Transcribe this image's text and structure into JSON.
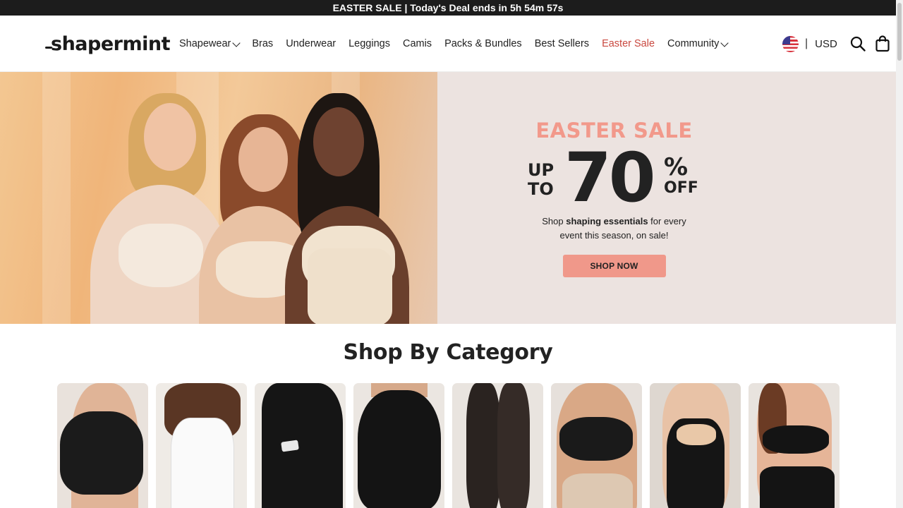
{
  "announcement": {
    "prefix": "EASTER SALE | Today's Deal ends in",
    "countdown": "5h 54m 57s"
  },
  "header": {
    "logo_text": "shapermint",
    "nav": [
      {
        "label": "Shapewear",
        "has_dropdown": true
      },
      {
        "label": "Bras",
        "has_dropdown": false
      },
      {
        "label": "Underwear",
        "has_dropdown": false
      },
      {
        "label": "Leggings",
        "has_dropdown": false
      },
      {
        "label": "Camis",
        "has_dropdown": false
      },
      {
        "label": "Packs & Bundles",
        "has_dropdown": false
      },
      {
        "label": "Best Sellers",
        "has_dropdown": false
      },
      {
        "label": "Easter Sale",
        "has_dropdown": false,
        "highlight_color": "#c9483f"
      },
      {
        "label": "Community",
        "has_dropdown": true
      }
    ],
    "separator": "|",
    "currency": "USD",
    "icons": [
      "us-flag-icon",
      "search-icon",
      "shopping-bag-icon"
    ]
  },
  "hero": {
    "headline": "EASTER SALE",
    "up": "UP",
    "to": "TO",
    "discount_number": "70",
    "percent": "%",
    "off": "OFF",
    "sub_line1_pre": "Shop ",
    "sub_line1_bold": "shaping essentials",
    "sub_line1_post": " for every",
    "sub_line2": "event this season, on sale!",
    "cta_label": "SHOP NOW",
    "accent_color": "#f2998b"
  },
  "categories": {
    "title": "Shop By Category",
    "items": [
      {
        "image": "black-bra"
      },
      {
        "image": "white-cami"
      },
      {
        "image": "black-leggings"
      },
      {
        "image": "black-shaper-shorts"
      },
      {
        "image": "black-tights"
      },
      {
        "image": "black-bra-beige-brief"
      },
      {
        "image": "black-bodysuit"
      },
      {
        "image": "black-swimsuit"
      }
    ]
  },
  "colors": {
    "top_bar": "#1c1c1c",
    "sale_red": "#c9483f",
    "cta": "#f0988a"
  }
}
